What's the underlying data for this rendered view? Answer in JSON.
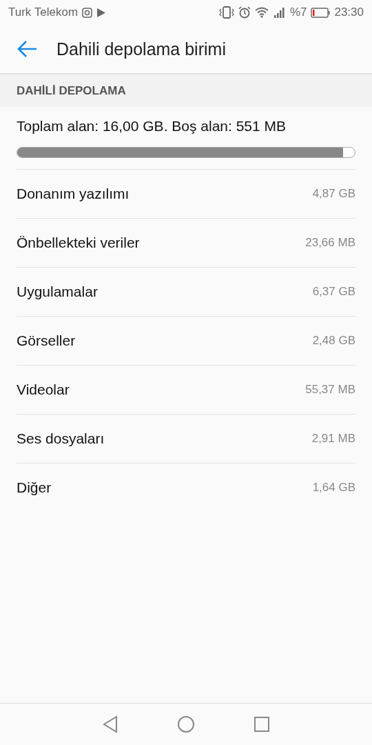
{
  "status_bar": {
    "carrier": "Turk Telekom",
    "battery_percent": "%7",
    "time": "23:30"
  },
  "header": {
    "title": "Dahili depolama birimi"
  },
  "section": {
    "title": "DAHİLİ DEPOLAMA",
    "summary": "Toplam alan: 16,00 GB. Boş alan: 551 MB",
    "level": 0.966
  },
  "items": [
    {
      "label": "Donanım yazılımı",
      "value": "4,87 GB"
    },
    {
      "label": "Önbellekteki veriler",
      "value": "23,66 MB"
    },
    {
      "label": "Uygulamalar",
      "value": "6,37 GB"
    },
    {
      "label": "Görseller",
      "value": "2,48 GB"
    },
    {
      "label": "Videolar",
      "value": "55,37 MB"
    },
    {
      "label": "Ses dosyaları",
      "value": "2,91 MB"
    },
    {
      "label": "Diğer",
      "value": "1,64 GB"
    }
  ]
}
